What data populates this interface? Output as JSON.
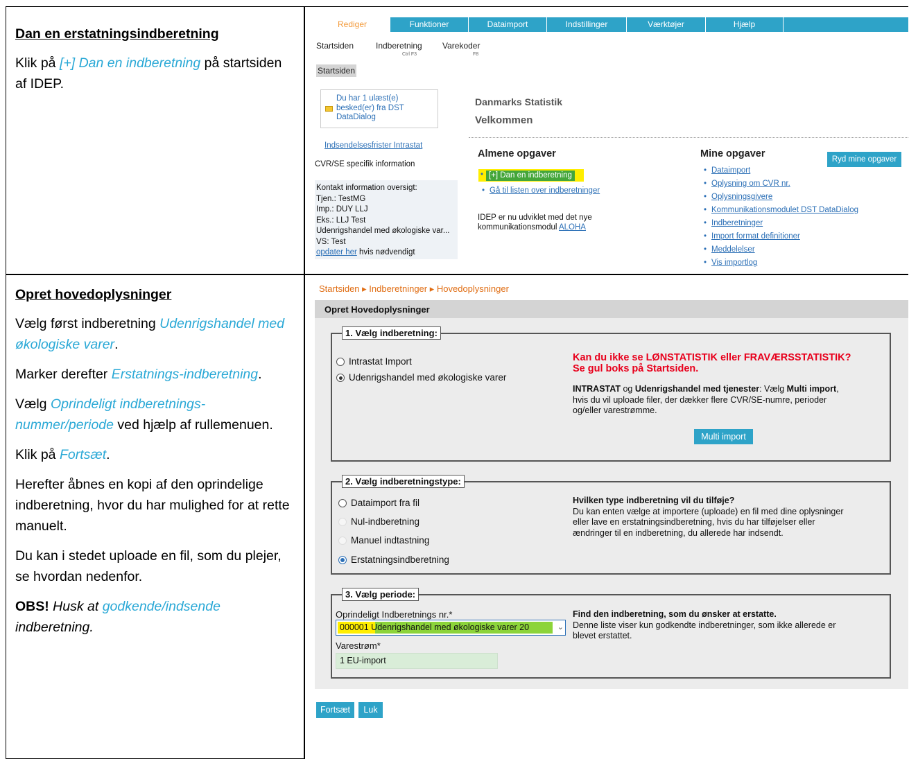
{
  "left": {
    "section1": {
      "heading": "Dan en erstatningsindberetning",
      "p1_prefix": "Klik på ",
      "p1_link": "[+] Dan en indberetning",
      "p1_suffix": " på startsiden af IDEP."
    },
    "section2": {
      "heading": "Opret hovedoplysninger",
      "p1_prefix": "Vælg først indberetning ",
      "p1_link": "Udenrigshandel med økologiske varer",
      "p1_suffix": ".",
      "p2_prefix": "Marker derefter ",
      "p2_link": "Erstatnings-indberetning",
      "p2_suffix": ".",
      "p3_prefix": "Vælg ",
      "p3_link": "Oprindeligt indberetnings-nummer/periode",
      "p3_suffix": " ved hjælp af rullemenuen.",
      "p4_prefix": "Klik på ",
      "p4_link": "Fortsæt",
      "p4_suffix": ".",
      "p5": "Herefter åbnes en kopi af den oprindelige indberetning, hvor du har mulighed for at rette manuelt.",
      "p6": "Du kan i stedet uploade en fil, som du plejer, se hvordan nedenfor.",
      "p7_bold": "OBS!",
      "p7_mid": " Husk at ",
      "p7_link": "godkende/indsende",
      "p7_end": " indberetning."
    }
  },
  "s1": {
    "menu": [
      "Rediger",
      "Funktioner",
      "Dataimport",
      "Indstillinger",
      "Værktøjer",
      "Hjælp"
    ],
    "sub": [
      {
        "label": "Startsiden",
        "key": ""
      },
      {
        "label": "Indberetning",
        "key": "Ctrl F3"
      },
      {
        "label": "Varekoder",
        "key": "F8"
      }
    ],
    "crumb": "Startsiden",
    "message": "Du har 1 ulæst(e) besked(er) fra DST DataDialog",
    "deadlines": "Indsendelsesfrister Intrastat",
    "cvr_info": "CVR/SE specifik information",
    "contact": {
      "l1": "Kontakt information oversigt:",
      "l2": "Tjen.: TestMG",
      "l3": "Imp.: DUY LLJ",
      "l4": "Eks.: LLJ Test",
      "l5": "Udenrigshandel med økologiske var...",
      "l6": "VS: Test",
      "update_link": "opdater her",
      "update_suffix": " hvis nødvendigt"
    },
    "org": "Danmarks Statistik",
    "welcome": "Velkommen",
    "general_title": "Almene opgaver",
    "general_items": [
      "[+] Dan en indberetning",
      "Gå til listen over indberetninger"
    ],
    "aloha_text": "IDEP er nu udviklet med det nye kommunikationsmodul",
    "aloha_link": "ALOHA",
    "my_title": "Mine opgaver",
    "clear_button": "Ryd mine opgaver",
    "my_items": [
      "Dataimport",
      "Oplysning om CVR nr.",
      "Oplysningsgivere",
      "Kommunikationsmodulet DST DataDialog",
      "Indberetninger",
      "Import format definitioner",
      "Meddelelser",
      "Vis importlog"
    ]
  },
  "s2": {
    "breadcrumb": "Startsiden ▸ Indberetninger ▸ Hovedoplysninger",
    "title": "Opret Hovedoplysninger",
    "fs1": {
      "legend": "1. Vælg indberetning:",
      "options": [
        "Intrastat Import",
        "Udenrigshandel med økologiske varer"
      ],
      "red1": "Kan du ikke se LØNSTATISTIK eller FRAVÆRSSTATISTIK?",
      "red2": "Se gul boks på Startsiden.",
      "info_b1": "INTRASTAT",
      "info_t1": " og ",
      "info_b2": "Udenrigshandel med tjenester",
      "info_t2": ": Vælg ",
      "info_b3": "Multi import",
      "info_t3": ",",
      "info_l2": "hvis du vil uploade filer, der dækker flere CVR/SE-numre, perioder",
      "info_l3": "og/eller varestrømme.",
      "multi_button": "Multi import"
    },
    "fs2": {
      "legend": "2. Vælg indberetningstype:",
      "options": [
        "Dataimport fra fil",
        "Nul-indberetning",
        "Manuel indtastning",
        "Erstatningsindberetning"
      ],
      "q": "Hvilken type indberetning vil du tilføje?",
      "l1": "Du kan enten vælge at importere (uploade) en fil med dine oplysninger",
      "l2": "eller lave en erstatningsindberetning, hvis du har tilføjelser eller",
      "l3": "ændringer til en indberetning, du allerede har indsendt."
    },
    "fs3": {
      "legend": "3. Vælg periode:",
      "orig_label": "Oprindeligt Indberetnings nr.*",
      "orig_value": "000001   Udenrigshandel med økologiske varer 20",
      "vare_label": "Varestrøm*",
      "vare_value": "1  EU-import",
      "find_title": "Find den indberetning, som du ønsker at erstatte.",
      "find_l1": "Denne liste viser kun godkendte indberetninger, som ikke allerede er",
      "find_l2": "blevet erstattet."
    },
    "continue_button": "Fortsæt",
    "close_button": "Luk"
  }
}
